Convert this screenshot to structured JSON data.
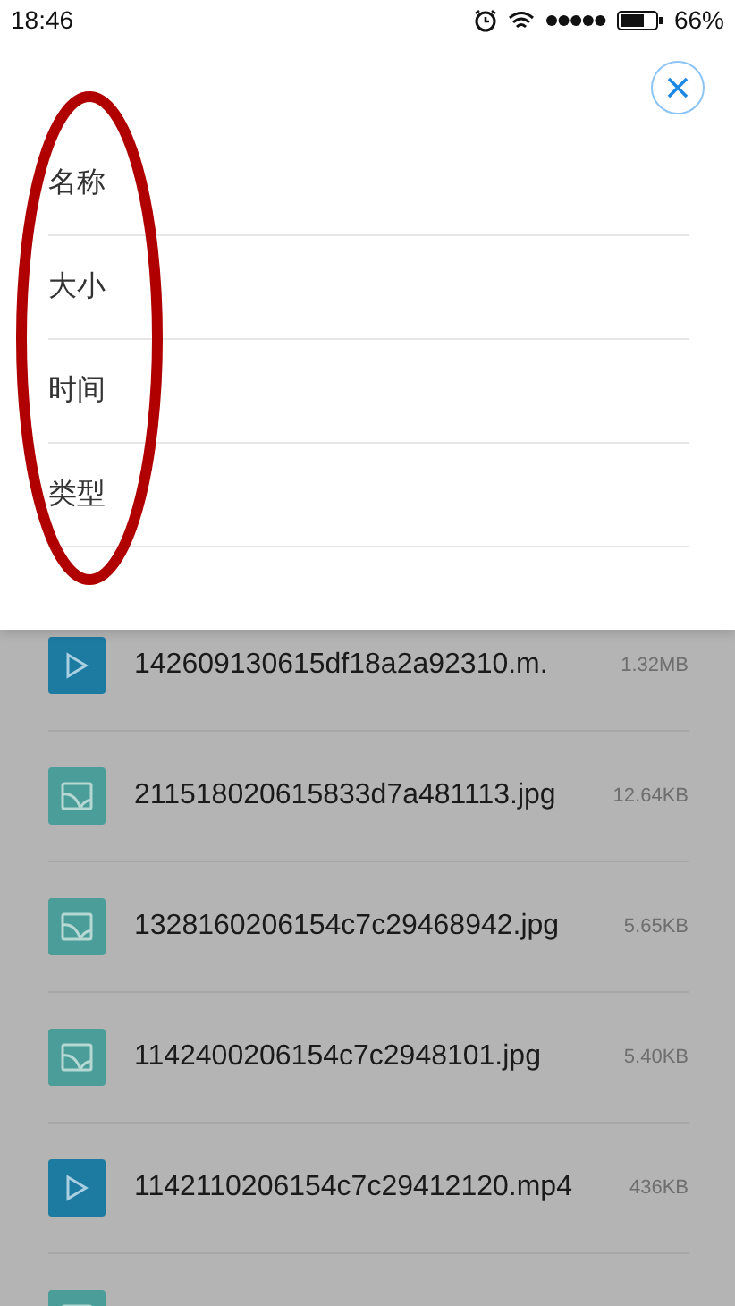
{
  "status_bar": {
    "time": "18:46",
    "battery": "66%"
  },
  "sort_menu": {
    "items": [
      {
        "label": "名称"
      },
      {
        "label": "大小"
      },
      {
        "label": "时间"
      },
      {
        "label": "类型"
      }
    ]
  },
  "files": [
    {
      "kind": "video",
      "name": "142609130615df18a2a92310.m.",
      "size": "1.32MB"
    },
    {
      "kind": "image",
      "name": "211518020615833d7a481113.jpg",
      "size": "12.64KB"
    },
    {
      "kind": "image",
      "name": "1328160206154c7c29468942.jpg",
      "size": "5.65KB"
    },
    {
      "kind": "image",
      "name": "1142400206154c7c2948101.jpg",
      "size": "5.40KB"
    },
    {
      "kind": "video",
      "name": "1142110206154c7c29412120.mp4",
      "size": "436KB"
    },
    {
      "kind": "image"
    }
  ]
}
